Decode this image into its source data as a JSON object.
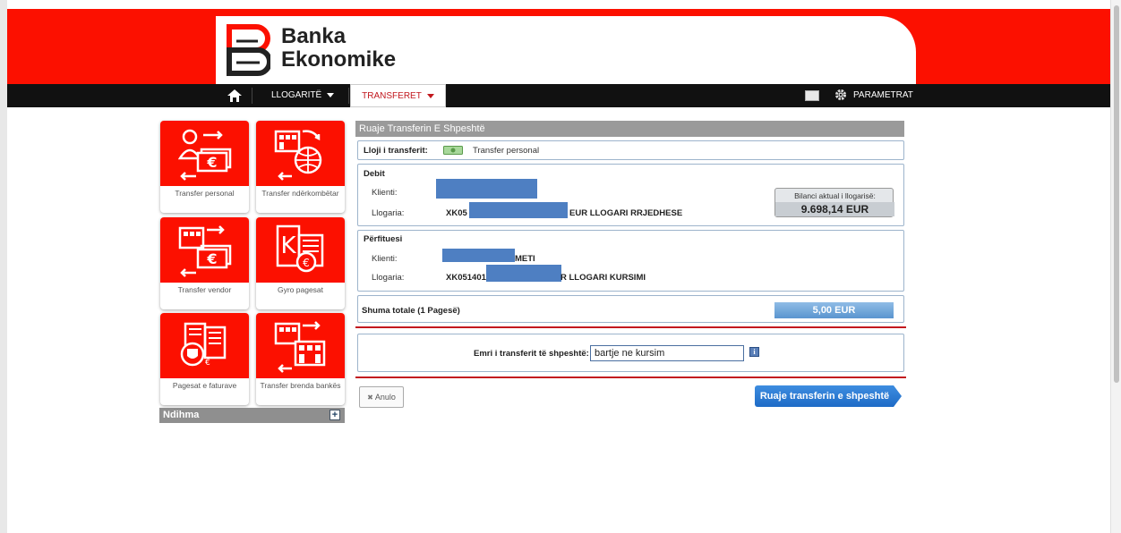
{
  "brand": {
    "line1": "Banka",
    "line2": "Ekonomike",
    "primary_color": "#fc1000"
  },
  "nav": {
    "home_icon": "home-icon",
    "accounts": "LLOGARITË",
    "transfers": "TRANSFERET",
    "mail_icon": "envelope-icon",
    "settings": "PARAMETRAT"
  },
  "sidebar": {
    "tiles": [
      {
        "label": "Transfer personal",
        "icon": "person-euro-transfer-icon"
      },
      {
        "label": "Transfer ndërkombëtar",
        "icon": "bank-globe-transfer-icon"
      },
      {
        "label": "Transfer vendor",
        "icon": "bank-euro-transfer-icon"
      },
      {
        "label": "Gyro pagesat",
        "icon": "kuna-euro-document-icon"
      },
      {
        "label": "Pagesat e faturave",
        "icon": "invoice-shield-icon"
      },
      {
        "label": "Transfer brenda bankës",
        "icon": "bank-to-bank-icon"
      }
    ],
    "help": {
      "title": "Ndihma",
      "expand": "+"
    }
  },
  "panel": {
    "title": "Ruaje Transferin E Shpeshtë",
    "type_label": "Lloji i transferit:",
    "type_value": "Transfer personal",
    "debit": {
      "title": "Debit",
      "client_label": "Klienti:",
      "account_label": "Llogaria:",
      "account_prefix": "XK05",
      "account_suffix": "EUR LLOGARI RRJEDHESE",
      "balance_label": "Bilanci aktual i llogarisë:",
      "balance_value": "9.698,14 EUR"
    },
    "beneficiary": {
      "title": "Përfituesi",
      "client_label": "Klienti:",
      "client_suffix": "METI",
      "account_label": "Llogaria:",
      "account_prefix": "XK051401",
      "account_suffix": "R LLOGARI KURSIMI"
    },
    "total_label": "Shuma totale (1 Pagesë)",
    "total_value": "5,00 EUR",
    "name_label": "Emri i transferit të shpeshtë:",
    "name_value": "bartje ne kursim",
    "cancel": "Anulo",
    "save": "Ruaje transferin e shpeshtë"
  }
}
